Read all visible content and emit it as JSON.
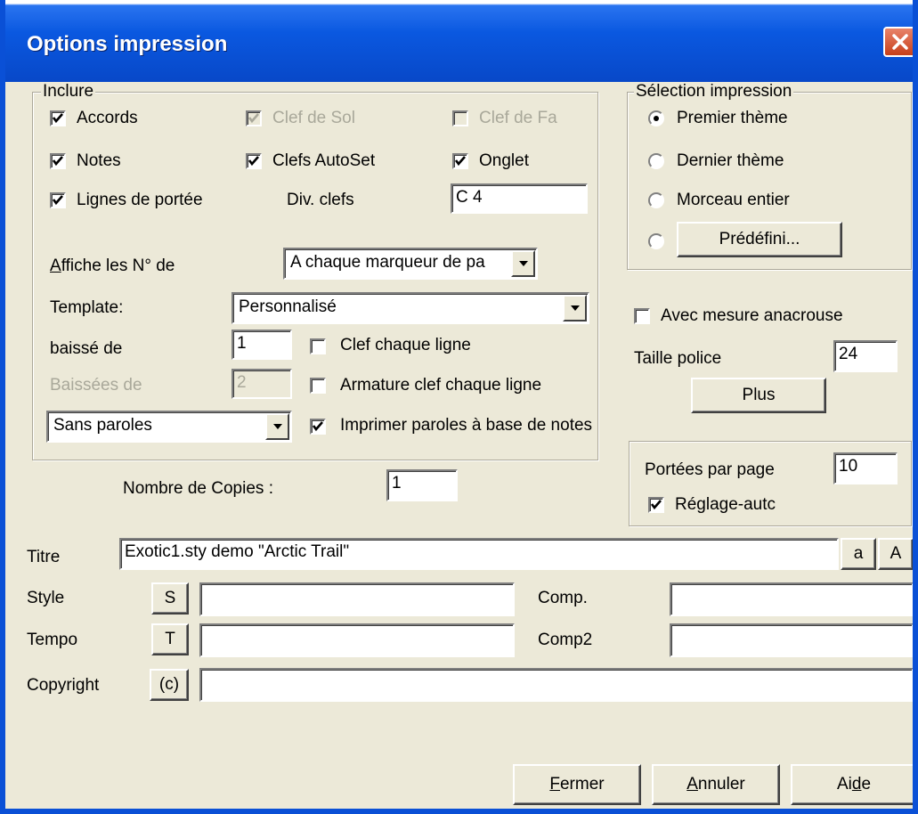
{
  "window": {
    "title": "Options impression"
  },
  "include": {
    "legend": "Inclure",
    "accords": "Accords",
    "clef_de_sol": "Clef de Sol",
    "clef_de_fa": "Clef de Fa",
    "notes": "Notes",
    "clefs_autoset": "Clefs AutoSet",
    "onglet": "Onglet",
    "lignes_de_portee": "Lignes de portée",
    "div_clefs_label": "Div. clefs",
    "div_clefs_value": "C 4",
    "affiche_label_pre": "A",
    "affiche_label_post": "ffiche les N° de",
    "affiche_value": "A chaque marqueur de pa",
    "template_label": "Template:",
    "template_value": "Personnalisé",
    "baisse_label": "baissé de",
    "baisse_value": "1",
    "baissees_label": "Baissées de",
    "baissees_value": "2",
    "clef_chaque_ligne": "Clef chaque ligne",
    "armature_clef": "Armature clef chaque ligne",
    "paroles_select": "Sans paroles",
    "imprimer_paroles": "Imprimer paroles à base de notes"
  },
  "selection": {
    "legend": "Sélection impression",
    "premier": "Premier thème",
    "dernier": "Dernier thème",
    "morceau": "Morceau entier",
    "predefini": "Prédéfini..."
  },
  "avec_mesure": "Avec mesure anacrouse",
  "taille_police_label": "Taille police",
  "taille_police_value": "24",
  "plus_button": "Plus",
  "portees": {
    "label": "Portées par page",
    "value": "10",
    "reglage": "Réglage-autc"
  },
  "copies_label": "Nombre de Copies :",
  "copies_value": "1",
  "fields": {
    "titre_label": "Titre",
    "titre_value": "Exotic1.sty demo \"Arctic Trail\"",
    "lower_btn": "a",
    "upper_btn": "A",
    "style_label": "Style",
    "style_btn": "S",
    "style_value": "",
    "tempo_label": "Tempo",
    "tempo_btn": "T",
    "tempo_value": "",
    "comp_label": "Comp.",
    "comp_value": "",
    "comp2_label": "Comp2",
    "comp2_value": "",
    "copyright_label": "Copyright",
    "copyright_btn": "(c)",
    "copyright_value": ""
  },
  "buttons": {
    "fermer_first": "F",
    "fermer_rest": "ermer",
    "annuler_first": "A",
    "annuler_rest": "nnuler",
    "aide_pre": "Ai",
    "aide_u": "d",
    "aide_post": "e"
  }
}
